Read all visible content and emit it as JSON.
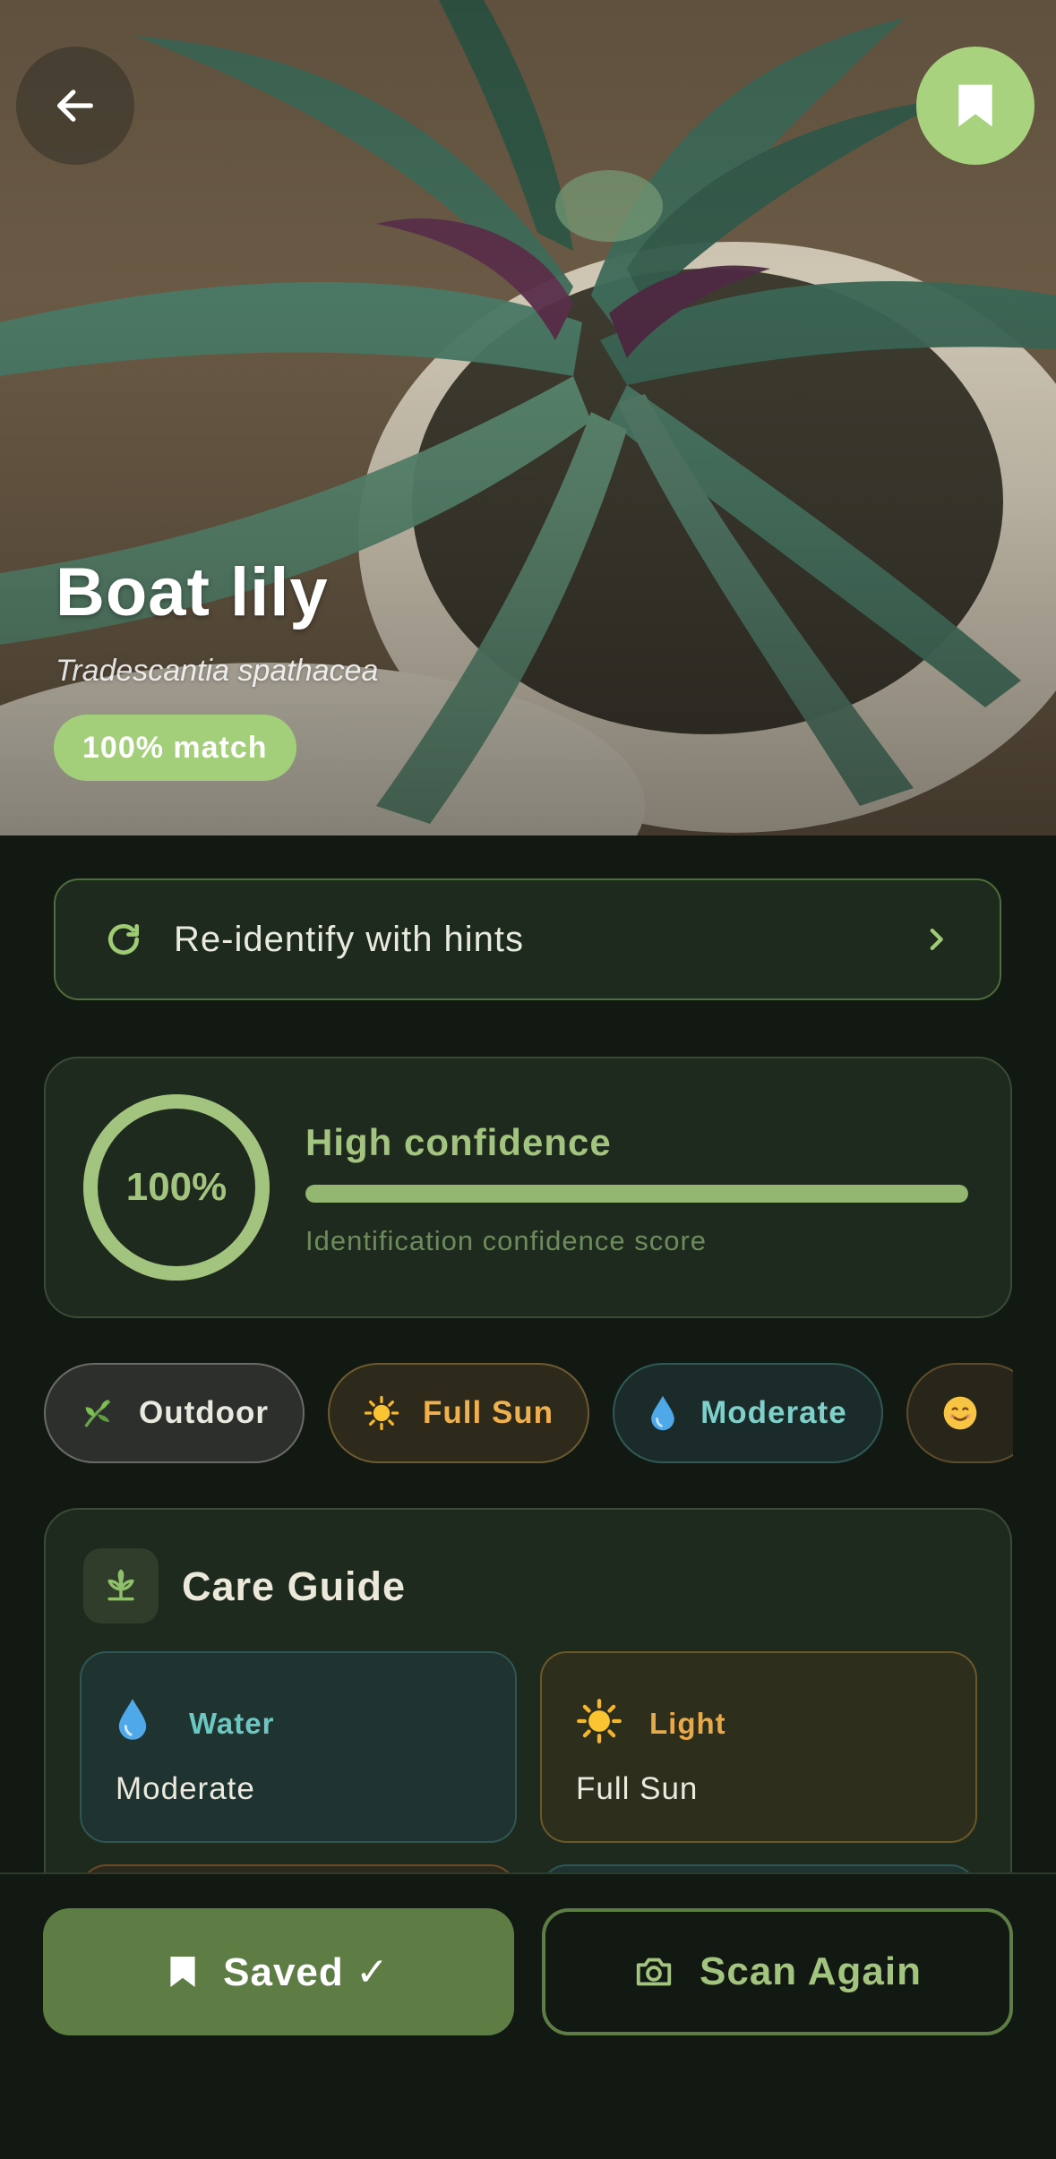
{
  "hero": {
    "name": "Boat lily",
    "scientific_name": "Tradescantia spathacea",
    "match_badge": "100% match"
  },
  "reidentify": {
    "label": "Re-identify with hints"
  },
  "confidence": {
    "percent_text": "100%",
    "percent_value": 100,
    "title": "High confidence",
    "subtitle": "Identification confidence score"
  },
  "chips": [
    {
      "label": "Outdoor",
      "icon": "herb-icon"
    },
    {
      "label": "Full Sun",
      "icon": "sun-icon"
    },
    {
      "label": "Moderate",
      "icon": "water-drop-icon"
    },
    {
      "label": "",
      "icon": "smiley-icon"
    }
  ],
  "care_guide": {
    "title": "Care Guide",
    "tiles": [
      {
        "label": "Water",
        "value": "Moderate",
        "icon": "water-drop-icon"
      },
      {
        "label": "Light",
        "value": "Full Sun",
        "icon": "sun-icon"
      }
    ]
  },
  "bottom": {
    "saved_label": "Saved ✓",
    "scan_label": "Scan Again"
  },
  "colors": {
    "background": "#121912",
    "accent": "#a3cf7a",
    "button_primary": "#5e7d45",
    "card": "#1f2a1e"
  }
}
